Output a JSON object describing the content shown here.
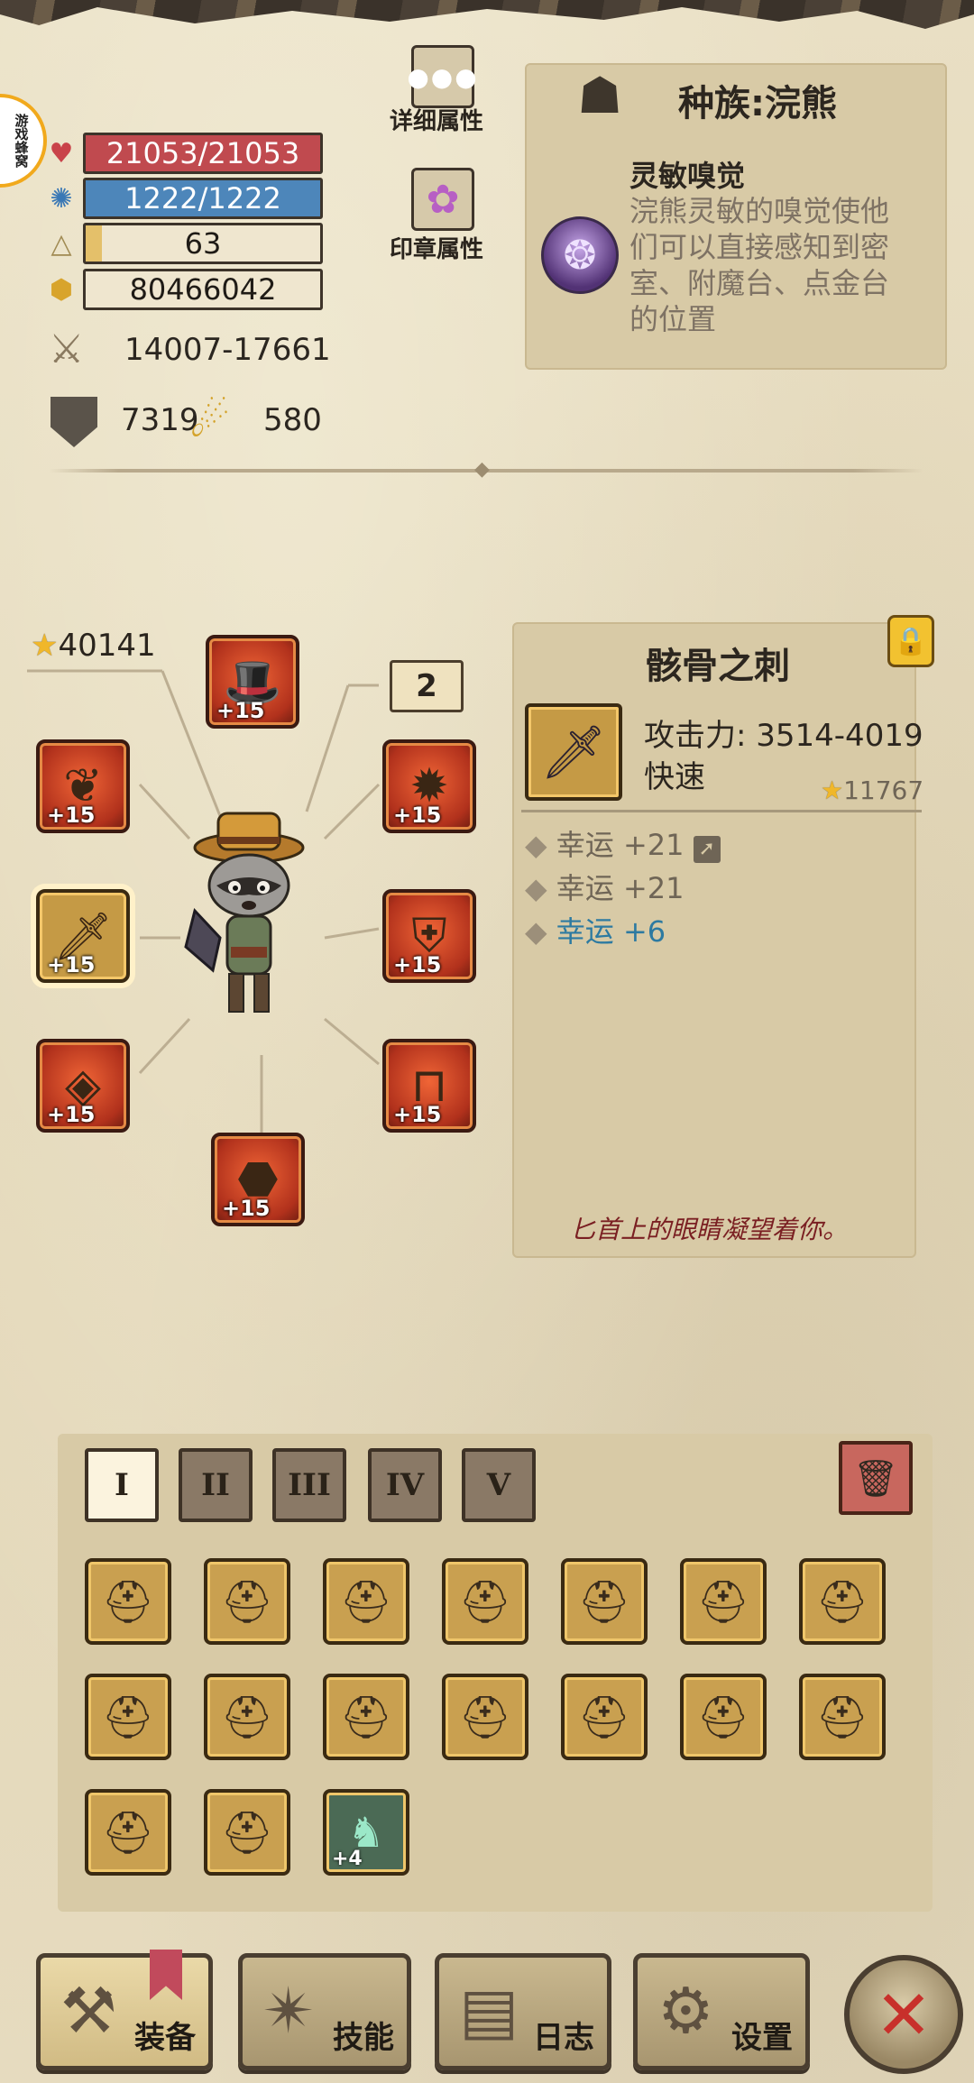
{
  "app_badge": "游戏蜂窝",
  "stats": {
    "hp": "21053/21053",
    "mp": "1222/1222",
    "level": "63",
    "gold": "80466042",
    "attack": "14007-17661",
    "armor": "7319",
    "crit": "580"
  },
  "side_buttons": {
    "detail_attrs": "详细属性",
    "seal_attrs": "印章属性"
  },
  "race": {
    "title": "种族:浣熊",
    "skill_name": "灵敏嗅觉",
    "skill_desc_lines": [
      "浣熊灵敏的嗅觉使他",
      "们可以直接感知到密",
      "室、附魔台、点金台",
      "的位置"
    ]
  },
  "equipment": {
    "power": "40141",
    "skill_points": "2",
    "slots": [
      {
        "name": "hat",
        "level": "+15"
      },
      {
        "name": "amulet",
        "level": "+15"
      },
      {
        "name": "necklace",
        "level": "+15"
      },
      {
        "name": "weapon",
        "level": "+15"
      },
      {
        "name": "armor",
        "level": "+15"
      },
      {
        "name": "ring",
        "level": "+15"
      },
      {
        "name": "pants",
        "level": "+15"
      },
      {
        "name": "boots",
        "level": "+15"
      }
    ]
  },
  "item": {
    "name": "骸骨之刺",
    "attack": "攻击力: 3514-4019",
    "speed": "快速",
    "score": "11767",
    "affixes": [
      "幸运 +21",
      "幸运 +21",
      "幸运 +6"
    ],
    "flavor": "匕首上的眼睛凝望着你。"
  },
  "inventory": {
    "tabs": [
      "I",
      "II",
      "III",
      "IV",
      "V"
    ],
    "special_plus": "+4"
  },
  "nav": {
    "equip": "装备",
    "skills": "技能",
    "log": "日志",
    "settings": "设置"
  },
  "colors": {
    "hp": "#c04a4f",
    "mp": "#4d86ba",
    "affix_blue": "#2d7aa1",
    "flavor": "#7a1f22"
  }
}
